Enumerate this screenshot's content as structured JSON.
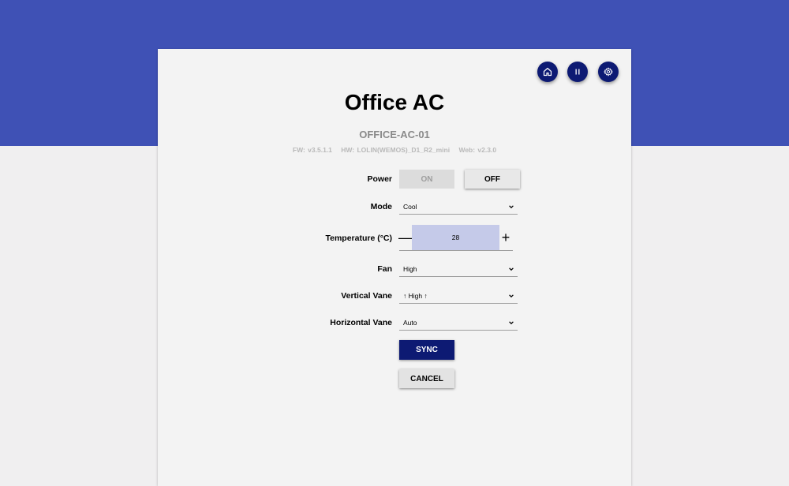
{
  "header": {
    "icons": [
      "home-icon",
      "pause-icon",
      "settings-icon"
    ],
    "title": "Office AC",
    "device_id": "OFFICE-AC-01",
    "versions": {
      "fw": "FW: v3.5.1.1",
      "hw": "HW: LOLIN(WEMOS)_D1_R2_mini",
      "web": "Web: v2.3.0"
    }
  },
  "form": {
    "power": {
      "label": "Power",
      "on_label": "ON",
      "off_label": "OFF"
    },
    "mode": {
      "label": "Mode",
      "value": "Cool"
    },
    "temperature": {
      "label": "Temperature (°C)",
      "value": "28",
      "minus": "—",
      "plus": "+"
    },
    "fan": {
      "label": "Fan",
      "value": "High"
    },
    "vertical_vane": {
      "label": "Vertical Vane",
      "value": "↑ High ↑"
    },
    "horizontal_vane": {
      "label": "Horizontal Vane",
      "value": "Auto"
    }
  },
  "actions": {
    "sync_label": "SYNC",
    "cancel_label": "CANCEL"
  },
  "colors": {
    "band": "#3f51b5",
    "primary_dark": "#0d1a73",
    "temp_field": "#c5cae9"
  }
}
